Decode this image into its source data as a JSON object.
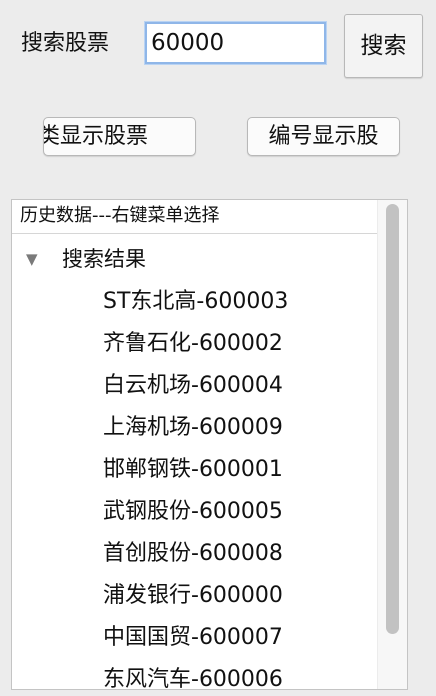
{
  "search": {
    "label": "搜索股票",
    "input_value": "60000",
    "button_label": "搜索"
  },
  "actions": {
    "category_label": "分类显示股票",
    "number_label": "编号显示股"
  },
  "history": {
    "header": "历史数据---右键菜单选择",
    "root_label": "搜索结果",
    "root_expanded": true,
    "expand_icon": "triangle-down-icon",
    "items": [
      "ST东北高-600003",
      "齐鲁石化-600002",
      "白云机场-600004",
      "上海机场-600009",
      "邯郸钢铁-600001",
      "武钢股份-600005",
      "首创股份-600008",
      "浦发银行-600000",
      "中国国贸-600007",
      "东风汽车-600006"
    ]
  }
}
